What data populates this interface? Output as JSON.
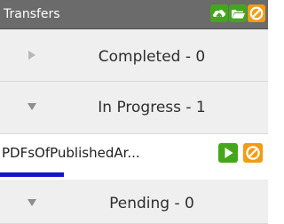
{
  "panel": {
    "title": "Transfers",
    "toolbar": [
      {
        "icon": "upload-cloud-icon",
        "color": "#44a71b"
      },
      {
        "icon": "folder-icon",
        "color": "#44a71b"
      },
      {
        "icon": "cancel-icon",
        "color": "#f39c12"
      }
    ]
  },
  "sections": {
    "completed": {
      "label": "Completed - 0",
      "expanded": false
    },
    "in_progress": {
      "label": "In Progress - 1",
      "expanded": true
    },
    "pending": {
      "label": "Pending - 0",
      "expanded": true
    }
  },
  "transfers": [
    {
      "name": "PDFsOfPublishedAr...",
      "progress": 0.24,
      "actions": [
        {
          "icon": "play-icon",
          "color": "#44a71b"
        },
        {
          "icon": "cancel-icon",
          "color": "#f39c12"
        }
      ]
    }
  ],
  "colors": {
    "header_bg": "#6b6b6b",
    "section_bg": "#efefef",
    "progress": "#1414c8",
    "accent_green": "#44a71b",
    "accent_orange": "#f39c12"
  }
}
